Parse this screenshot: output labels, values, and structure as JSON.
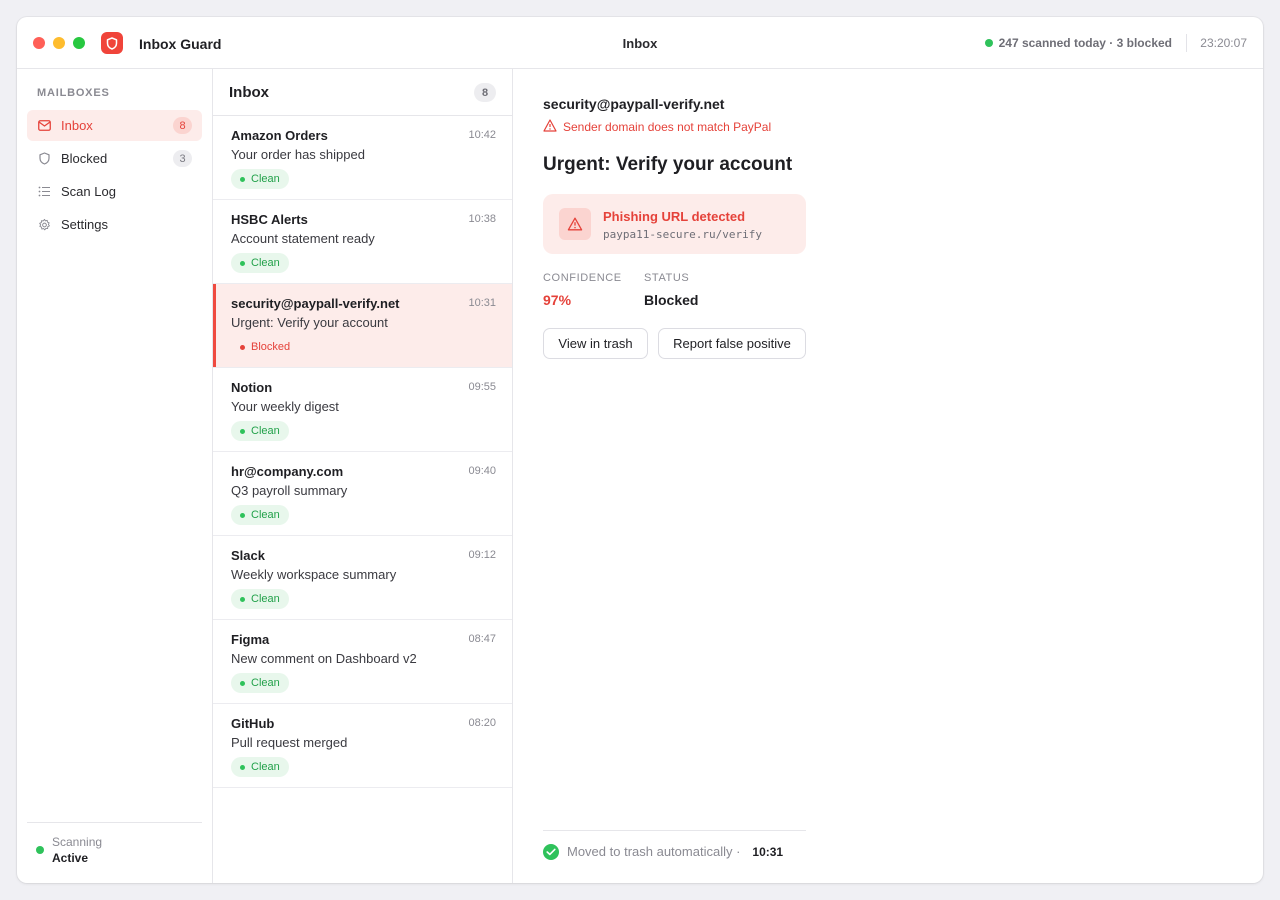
{
  "titlebar": {
    "app_title": "Inbox Guard",
    "window_title": "Inbox",
    "scan_stats": "247 scanned today · 3 blocked",
    "clock": "23:20:07"
  },
  "sidebar": {
    "section_label": "MAILBOXES",
    "items": [
      {
        "label": "Inbox",
        "icon": "mail-icon",
        "count": "8",
        "active": true
      },
      {
        "label": "Blocked",
        "icon": "shield-icon",
        "count": "3",
        "active": false
      },
      {
        "label": "Scan Log",
        "icon": "list-icon",
        "count": "",
        "active": false
      },
      {
        "label": "Settings",
        "icon": "gear-icon",
        "count": "",
        "active": false
      }
    ],
    "status_label": "Scanning",
    "status_value": "Active"
  },
  "list": {
    "title": "Inbox",
    "count": "8",
    "items": [
      {
        "sender": "Amazon Orders",
        "time": "10:42",
        "subject": "Your order has shipped",
        "status": "Clean"
      },
      {
        "sender": "HSBC Alerts",
        "time": "10:38",
        "subject": "Account statement ready",
        "status": "Clean"
      },
      {
        "sender": "security@paypall-verify.net",
        "time": "10:31",
        "subject": "Urgent: Verify your account",
        "status": "Blocked"
      },
      {
        "sender": "Notion",
        "time": "09:55",
        "subject": "Your weekly digest",
        "status": "Clean"
      },
      {
        "sender": "hr@company.com",
        "time": "09:40",
        "subject": "Q3 payroll summary",
        "status": "Clean"
      },
      {
        "sender": "Slack",
        "time": "09:12",
        "subject": "Weekly workspace summary",
        "status": "Clean"
      },
      {
        "sender": "Figma",
        "time": "08:47",
        "subject": "New comment on Dashboard v2",
        "status": "Clean"
      },
      {
        "sender": "GitHub",
        "time": "08:20",
        "subject": "Pull request merged",
        "status": "Clean"
      }
    ]
  },
  "detail": {
    "sender": "security@paypall-verify.net",
    "warning": "Sender domain does not match PayPal",
    "subject": "Urgent: Verify your account",
    "alert_title": "Phishing URL detected",
    "alert_url": "paypa11-secure.ru/verify",
    "confidence_label": "CONFIDENCE",
    "confidence_value": "97%",
    "status_label": "STATUS",
    "status_value": "Blocked",
    "btn_view_trash": "View in trash",
    "btn_report": "Report false positive",
    "footer_text": "Moved to trash automatically ·",
    "footer_time": "10:31"
  },
  "colors": {
    "accent": "#e5423a",
    "danger_bg": "#fdecea",
    "clean": "#2fc25b"
  }
}
